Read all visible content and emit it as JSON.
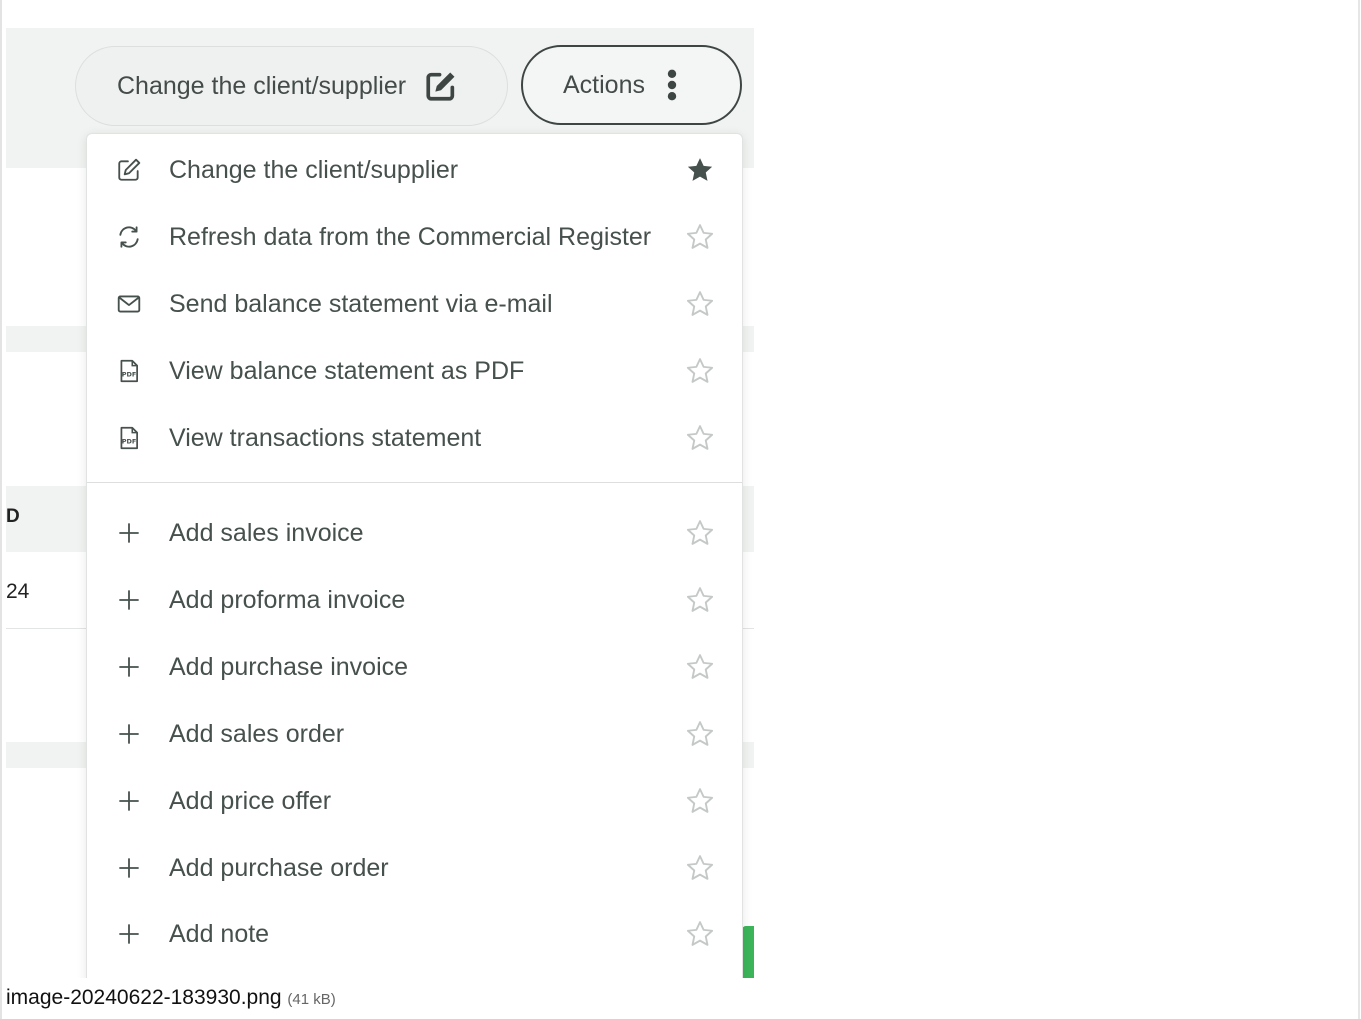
{
  "buttons": {
    "change_label": "Change the client/supplier",
    "actions_label": "Actions"
  },
  "background": {
    "column_header": "D",
    "cell_value": "24"
  },
  "menu": {
    "group1": [
      {
        "label": "Change the client/supplier",
        "icon": "edit-icon",
        "starred": true
      },
      {
        "label": "Refresh data from the Commercial Register",
        "icon": "refresh-icon",
        "starred": false
      },
      {
        "label": "Send balance statement via e-mail",
        "icon": "envelope-icon",
        "starred": false
      },
      {
        "label": "View balance statement as PDF",
        "icon": "pdf-icon",
        "starred": false
      },
      {
        "label": "View transactions statement",
        "icon": "pdf-icon",
        "starred": false
      }
    ],
    "group2": [
      {
        "label": "Add sales invoice",
        "icon": "plus-icon",
        "starred": false
      },
      {
        "label": "Add proforma invoice",
        "icon": "plus-icon",
        "starred": false
      },
      {
        "label": "Add purchase invoice",
        "icon": "plus-icon",
        "starred": false
      },
      {
        "label": "Add sales order",
        "icon": "plus-icon",
        "starred": false
      },
      {
        "label": "Add price offer",
        "icon": "plus-icon",
        "starred": false
      },
      {
        "label": "Add purchase order",
        "icon": "plus-icon",
        "starred": false
      },
      {
        "label": "Add note",
        "icon": "plus-icon",
        "starred": false
      }
    ]
  },
  "caption": {
    "filename": "image-20240622-183930.png",
    "size": "(41 kB)"
  },
  "colors": {
    "text": "#46504d",
    "star_filled": "#46504d",
    "star_empty": "#c4c9c7",
    "accent_green": "#3cb55a"
  }
}
